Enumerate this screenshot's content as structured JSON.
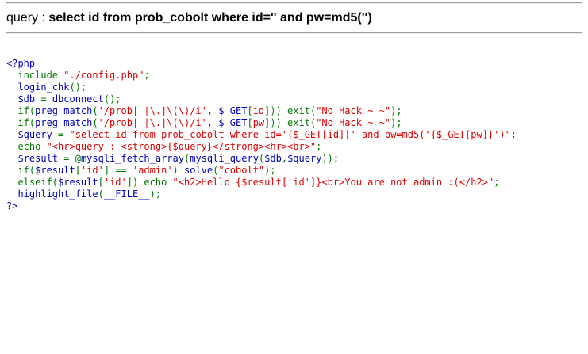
{
  "query": {
    "label": "query : ",
    "sql": "select id from prob_cobolt where id='' and pw=md5('')"
  },
  "source": {
    "lines": [
      [
        {
          "c": "html",
          "t": "<?php"
        }
      ],
      [
        {
          "c": "kw",
          "t": "  include "
        },
        {
          "c": "str",
          "t": "\"./config.php\""
        },
        {
          "c": "kw",
          "t": ";"
        }
      ],
      [
        {
          "c": "kw",
          "t": "  "
        },
        {
          "c": "var",
          "t": "login_chk"
        },
        {
          "c": "kw",
          "t": "();"
        }
      ],
      [
        {
          "c": "kw",
          "t": "  "
        },
        {
          "c": "var",
          "t": "$db"
        },
        {
          "c": "kw",
          "t": " = "
        },
        {
          "c": "var",
          "t": "dbconnect"
        },
        {
          "c": "kw",
          "t": "();"
        }
      ],
      [
        {
          "c": "kw",
          "t": "  if("
        },
        {
          "c": "var",
          "t": "preg_match"
        },
        {
          "c": "kw",
          "t": "("
        },
        {
          "c": "str",
          "t": "'/prob|_|\\.|\\(\\)/i'"
        },
        {
          "c": "kw",
          "t": ", "
        },
        {
          "c": "var",
          "t": "$_GET"
        },
        {
          "c": "kw",
          "t": "["
        },
        {
          "c": "str",
          "t": "id"
        },
        {
          "c": "kw",
          "t": "])) exit("
        },
        {
          "c": "str",
          "t": "\"No Hack ~_~\""
        },
        {
          "c": "kw",
          "t": ");"
        }
      ],
      [
        {
          "c": "kw",
          "t": "  if("
        },
        {
          "c": "var",
          "t": "preg_match"
        },
        {
          "c": "kw",
          "t": "("
        },
        {
          "c": "str",
          "t": "'/prob|_|\\.|\\(\\)/i'"
        },
        {
          "c": "kw",
          "t": ", "
        },
        {
          "c": "var",
          "t": "$_GET"
        },
        {
          "c": "kw",
          "t": "["
        },
        {
          "c": "str",
          "t": "pw"
        },
        {
          "c": "kw",
          "t": "])) exit("
        },
        {
          "c": "str",
          "t": "\"No Hack ~_~\""
        },
        {
          "c": "kw",
          "t": ");"
        }
      ],
      [
        {
          "c": "kw",
          "t": "  "
        },
        {
          "c": "var",
          "t": "$query"
        },
        {
          "c": "kw",
          "t": " = "
        },
        {
          "c": "str",
          "t": "\"select id from prob_cobolt where id='{$_GET[id]}' and pw=md5('{$_GET[pw]}')\""
        },
        {
          "c": "kw",
          "t": ";"
        }
      ],
      [
        {
          "c": "kw",
          "t": "  echo "
        },
        {
          "c": "str",
          "t": "\"<hr>query : <strong>{$query}</strong><hr><br>\""
        },
        {
          "c": "kw",
          "t": ";"
        }
      ],
      [
        {
          "c": "kw",
          "t": "  "
        },
        {
          "c": "var",
          "t": "$result"
        },
        {
          "c": "kw",
          "t": " = @"
        },
        {
          "c": "var",
          "t": "mysqli_fetch_array"
        },
        {
          "c": "kw",
          "t": "("
        },
        {
          "c": "var",
          "t": "mysqli_query"
        },
        {
          "c": "kw",
          "t": "("
        },
        {
          "c": "var",
          "t": "$db"
        },
        {
          "c": "kw",
          "t": ","
        },
        {
          "c": "var",
          "t": "$query"
        },
        {
          "c": "kw",
          "t": "));"
        }
      ],
      [
        {
          "c": "kw",
          "t": "  if("
        },
        {
          "c": "var",
          "t": "$result"
        },
        {
          "c": "kw",
          "t": "["
        },
        {
          "c": "str",
          "t": "'id'"
        },
        {
          "c": "kw",
          "t": "] == "
        },
        {
          "c": "str",
          "t": "'admin'"
        },
        {
          "c": "kw",
          "t": ") "
        },
        {
          "c": "var",
          "t": "solve"
        },
        {
          "c": "kw",
          "t": "("
        },
        {
          "c": "str",
          "t": "\"cobolt\""
        },
        {
          "c": "kw",
          "t": ");"
        }
      ],
      [
        {
          "c": "kw",
          "t": "  elseif("
        },
        {
          "c": "var",
          "t": "$result"
        },
        {
          "c": "kw",
          "t": "["
        },
        {
          "c": "str",
          "t": "'id'"
        },
        {
          "c": "kw",
          "t": "]) echo "
        },
        {
          "c": "str",
          "t": "\"<h2>Hello {$result['id']}<br>You are not admin :(</h2>\""
        },
        {
          "c": "kw",
          "t": ";"
        }
      ],
      [
        {
          "c": "kw",
          "t": "  "
        },
        {
          "c": "var",
          "t": "highlight_file"
        },
        {
          "c": "kw",
          "t": "("
        },
        {
          "c": "var",
          "t": "__FILE__"
        },
        {
          "c": "kw",
          "t": ");"
        }
      ],
      [
        {
          "c": "html",
          "t": "?>"
        }
      ]
    ]
  },
  "colors": {
    "html": "#0000bb",
    "keyword": "#007700",
    "string": "#dd0000",
    "variable": "#0000bb"
  }
}
